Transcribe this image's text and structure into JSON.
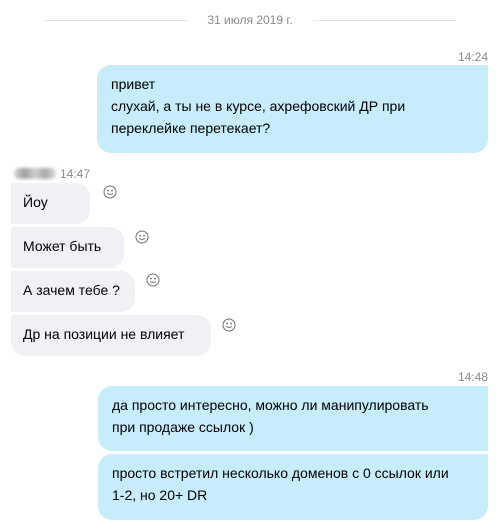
{
  "date_separator": "31 июля 2019 г.",
  "outgoing_group_1": {
    "time": "14:24",
    "lines": [
      "привет",
      "слухай, а ты не в курсе, ахрефовский ДР при",
      "переклейке перетекает?"
    ]
  },
  "incoming_group": {
    "sender_name_blurred": "██████",
    "time": "14:47",
    "messages": [
      {
        "text": "Йоу"
      },
      {
        "text": "Может быть"
      },
      {
        "text": "А зачем тебе ?"
      },
      {
        "text": "Др на позиции не влияет"
      }
    ],
    "reaction_icon": "smiley-face-icon"
  },
  "outgoing_group_2": {
    "time": "14:48",
    "messages": [
      {
        "lines": [
          "да просто интересно, можно ли манипулировать",
          "при продаже ссылок )"
        ]
      },
      {
        "lines": [
          "просто встретил несколько доменов с 0 ссылок или",
          "1-2, но 20+ DR"
        ]
      }
    ]
  },
  "colors": {
    "outgoing_bubble": "#c7ecfc",
    "incoming_bubble": "#eff1f4",
    "meta_text": "#8a8a8a"
  }
}
